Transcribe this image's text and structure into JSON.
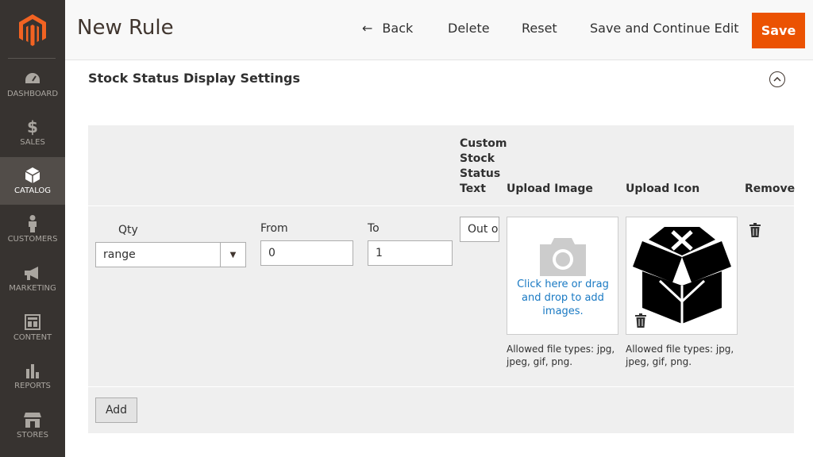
{
  "sidebar": {
    "items": [
      {
        "label": "DASHBOARD",
        "icon": "dashboard-icon"
      },
      {
        "label": "SALES",
        "icon": "dollar-icon"
      },
      {
        "label": "CATALOG",
        "icon": "box-icon",
        "active": true
      },
      {
        "label": "CUSTOMERS",
        "icon": "person-icon"
      },
      {
        "label": "MARKETING",
        "icon": "megaphone-icon"
      },
      {
        "label": "CONTENT",
        "icon": "content-icon"
      },
      {
        "label": "REPORTS",
        "icon": "bar-chart-icon"
      },
      {
        "label": "STORES",
        "icon": "store-icon"
      }
    ]
  },
  "header": {
    "title": "New Rule",
    "back_label": "Back",
    "delete_label": "Delete",
    "reset_label": "Reset",
    "save_continue_label": "Save and Continue Edit",
    "save_label": "Save"
  },
  "section": {
    "title": "Stock Status Display Settings"
  },
  "grid": {
    "headers": {
      "custom_text": [
        "Custom",
        "Stock",
        "Status",
        "Text"
      ],
      "upload_image": "Upload Image",
      "upload_icon": "Upload Icon",
      "remove": "Remove"
    },
    "row": {
      "qty_label": "Qty",
      "qty_value": "range",
      "from_label": "From",
      "from_value": "0",
      "to_label": "To",
      "to_value": "1",
      "custom_text_value": "Out o",
      "upload_prompt": [
        "Click here or drag",
        "and drop to add",
        "images."
      ],
      "allowed_types": [
        "Allowed file types: jpg,",
        "jpeg, gif, png."
      ]
    },
    "add_label": "Add"
  },
  "colors": {
    "sidebar_bg": "#373330",
    "accent": "#eb5202",
    "link": "#1979c3",
    "grid_bg": "#efefef"
  }
}
